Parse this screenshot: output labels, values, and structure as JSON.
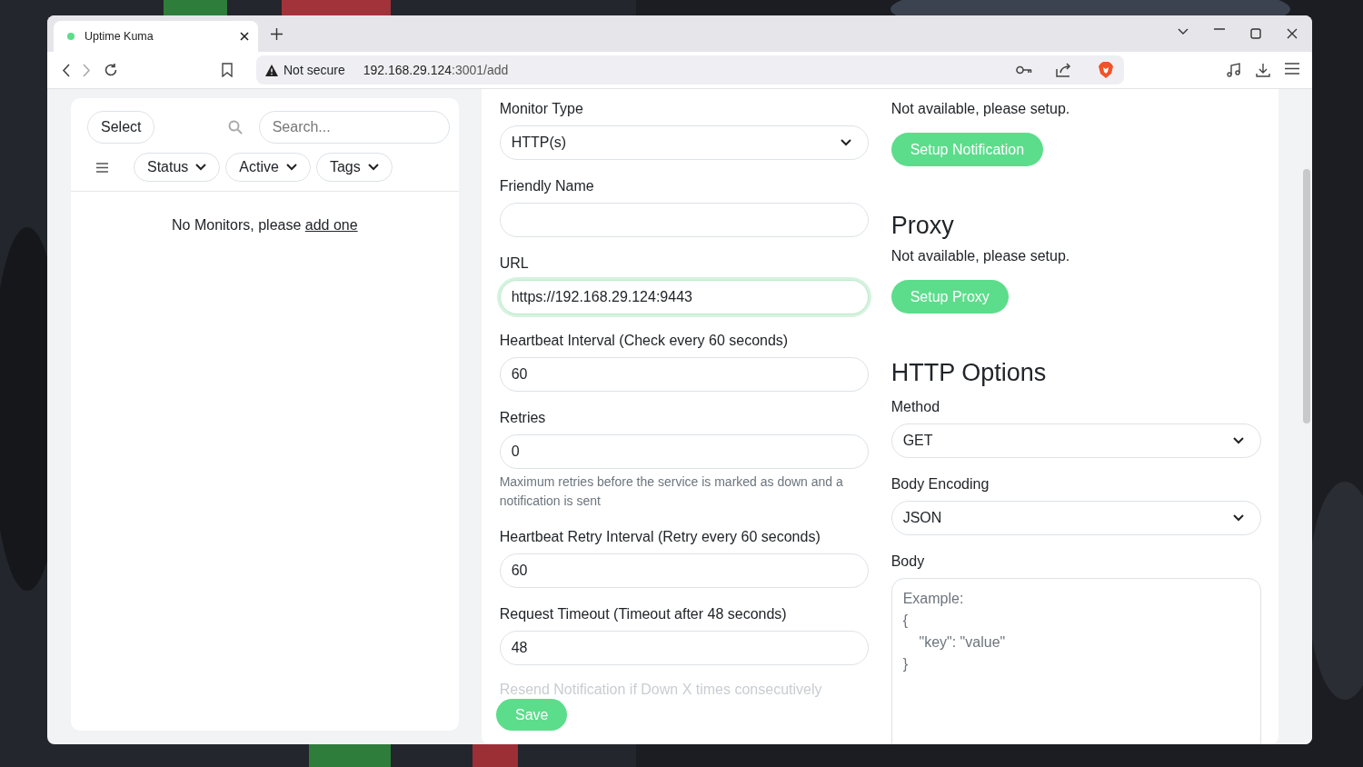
{
  "browser": {
    "tab": {
      "title": "Uptime Kuma"
    },
    "address": {
      "security": "Not secure",
      "host": "192.168.29.124",
      "path": ":3001/add"
    }
  },
  "sidebar": {
    "select_button": "Select",
    "search": {
      "placeholder": "Search..."
    },
    "filters": [
      "Status",
      "Active",
      "Tags"
    ],
    "empty": {
      "text": "No Monitors, please",
      "link": "add one"
    }
  },
  "form_left": [
    {
      "kind": "select",
      "label": "Monitor Type",
      "value": "HTTP(s)",
      "focused": false
    },
    {
      "kind": "input",
      "label": "Friendly Name",
      "focused": false
    },
    {
      "kind": "input",
      "label": "URL",
      "value": "https://192.168.29.124:9443",
      "focused": true
    },
    {
      "kind": "input",
      "label": "Heartbeat Interval (Check every 60 seconds)",
      "value": "60",
      "focused": false
    },
    {
      "kind": "input",
      "label": "Retries",
      "value": "0",
      "focused": false,
      "hint": "Maximum retries before the service is marked as down and a notification is sent"
    },
    {
      "kind": "input",
      "label": "Heartbeat Retry Interval (Retry every 60 seconds)",
      "value": "60",
      "focused": false
    },
    {
      "kind": "input",
      "label": "Request Timeout (Timeout after 48 seconds)",
      "value": "48",
      "focused": false
    },
    {
      "kind": "faded",
      "label": "Resend Notification if Down X times consecutively"
    }
  ],
  "form_right": [
    {
      "kind": "text",
      "text": "Not available, please setup."
    },
    {
      "kind": "button",
      "text": "Setup Notification"
    },
    {
      "kind": "heading",
      "text": "Proxy"
    },
    {
      "kind": "text",
      "text": "Not available, please setup."
    },
    {
      "kind": "button",
      "text": "Setup Proxy"
    },
    {
      "kind": "heading",
      "text": "HTTP Options"
    },
    {
      "kind": "select",
      "label": "Method",
      "value": "GET"
    },
    {
      "kind": "select",
      "label": "Body Encoding",
      "value": "JSON"
    },
    {
      "kind": "textarea",
      "label": "Body",
      "placeholder": "Example:\n{\n    \"key\": \"value\"\n}"
    }
  ],
  "save_button": "Save"
}
